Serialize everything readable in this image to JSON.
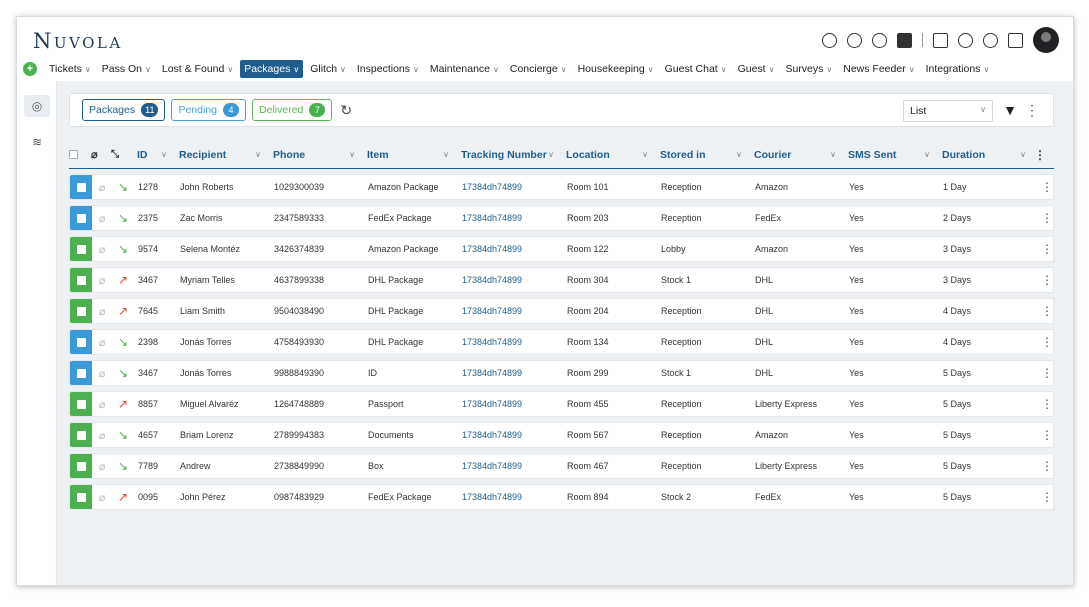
{
  "app": {
    "logo": "Nuvola"
  },
  "nav": [
    {
      "label": "Tickets",
      "active": false
    },
    {
      "label": "Pass On",
      "active": false
    },
    {
      "label": "Lost & Found",
      "active": false
    },
    {
      "label": "Packages",
      "active": true
    },
    {
      "label": "Glitch",
      "active": false
    },
    {
      "label": "Inspections",
      "active": false
    },
    {
      "label": "Maintenance",
      "active": false
    },
    {
      "label": "Concierge",
      "active": false
    },
    {
      "label": "Housekeeping",
      "active": false
    },
    {
      "label": "Guest Chat",
      "active": false
    },
    {
      "label": "Guest",
      "active": false
    },
    {
      "label": "Surveys",
      "active": false
    },
    {
      "label": "News Feeder",
      "active": false
    },
    {
      "label": "Integrations",
      "active": false
    }
  ],
  "toolbar": {
    "pills": [
      {
        "label": "Packages",
        "count": "11"
      },
      {
        "label": "Pending",
        "count": "4"
      },
      {
        "label": "Delivered",
        "count": "7"
      }
    ],
    "view": "List"
  },
  "columns": {
    "id": "ID",
    "recipient": "Recipient",
    "phone": "Phone",
    "item": "Item",
    "tracking": "Tracking Number",
    "location": "Location",
    "stored": "Stored in",
    "courier": "Courier",
    "sms": "SMS Sent",
    "duration": "Duration"
  },
  "rows": [
    {
      "status": "blue",
      "dir": "in",
      "id": "1278",
      "recipient": "John Roberts",
      "phone": "1029300039",
      "item": "Amazon Package",
      "tracking": "17384dh74899",
      "location": "Room 101",
      "stored": "Reception",
      "courier": "Amazon",
      "sms": "Yes",
      "duration": "1 Day"
    },
    {
      "status": "blue",
      "dir": "in",
      "id": "2375",
      "recipient": "Zac Morris",
      "phone": "2347589333",
      "item": "FedEx Package",
      "tracking": "17384dh74899",
      "location": "Room 203",
      "stored": "Reception",
      "courier": "FedEx",
      "sms": "Yes",
      "duration": "2 Days"
    },
    {
      "status": "green",
      "dir": "in",
      "id": "9574",
      "recipient": "Selena Montéz",
      "phone": "3426374839",
      "item": "Amazon Package",
      "tracking": "17384dh74899",
      "location": "Room 122",
      "stored": "Lobby",
      "courier": "Amazon",
      "sms": "Yes",
      "duration": "3 Days"
    },
    {
      "status": "green",
      "dir": "out",
      "id": "3467",
      "recipient": "Myriam Telles",
      "phone": "4637899338",
      "item": "DHL Package",
      "tracking": "17384dh74899",
      "location": "Room 304",
      "stored": "Stock 1",
      "courier": "DHL",
      "sms": "Yes",
      "duration": "3 Days"
    },
    {
      "status": "green",
      "dir": "out",
      "id": "7645",
      "recipient": "Liam Smith",
      "phone": "9504038490",
      "item": "DHL Package",
      "tracking": "17384dh74899",
      "location": "Room 204",
      "stored": "Reception",
      "courier": "DHL",
      "sms": "Yes",
      "duration": "4 Days"
    },
    {
      "status": "blue",
      "dir": "in",
      "id": "2398",
      "recipient": "Jonás Torres",
      "phone": "4758493930",
      "item": "DHL Package",
      "tracking": "17384dh74899",
      "location": "Room 134",
      "stored": "Reception",
      "courier": "DHL",
      "sms": "Yes",
      "duration": "4 Days"
    },
    {
      "status": "blue",
      "dir": "in",
      "id": "3467",
      "recipient": "Jonás Torres",
      "phone": "9988849390",
      "item": "ID",
      "tracking": "17384dh74899",
      "location": "Room 299",
      "stored": "Stock 1",
      "courier": "DHL",
      "sms": "Yes",
      "duration": "5 Days"
    },
    {
      "status": "green",
      "dir": "out",
      "id": "8857",
      "recipient": "Miguel Alvaréz",
      "phone": "1264748889",
      "item": "Passport",
      "tracking": "17384dh74899",
      "location": "Room 455",
      "stored": "Reception",
      "courier": "Liberty Express",
      "sms": "Yes",
      "duration": "5 Days"
    },
    {
      "status": "green",
      "dir": "in",
      "id": "4657",
      "recipient": "Briam Lorenz",
      "phone": "2789994383",
      "item": "Documents",
      "tracking": "17384dh74899",
      "location": "Room 567",
      "stored": "Reception",
      "courier": "Amazon",
      "sms": "Yes",
      "duration": "5 Days"
    },
    {
      "status": "green",
      "dir": "in",
      "id": "7789",
      "recipient": "Andrew",
      "phone": "2738849990",
      "item": "Box",
      "tracking": "17384dh74899",
      "location": "Room 467",
      "stored": "Reception",
      "courier": "Liberty Express",
      "sms": "Yes",
      "duration": "5 Days"
    },
    {
      "status": "green",
      "dir": "out",
      "id": "0095",
      "recipient": "John Pérez",
      "phone": "0987483929",
      "item": "FedEx Package",
      "tracking": "17384dh74899",
      "location": "Room 894",
      "stored": "Stock 2",
      "courier": "FedEx",
      "sms": "Yes",
      "duration": "5 Days"
    }
  ]
}
